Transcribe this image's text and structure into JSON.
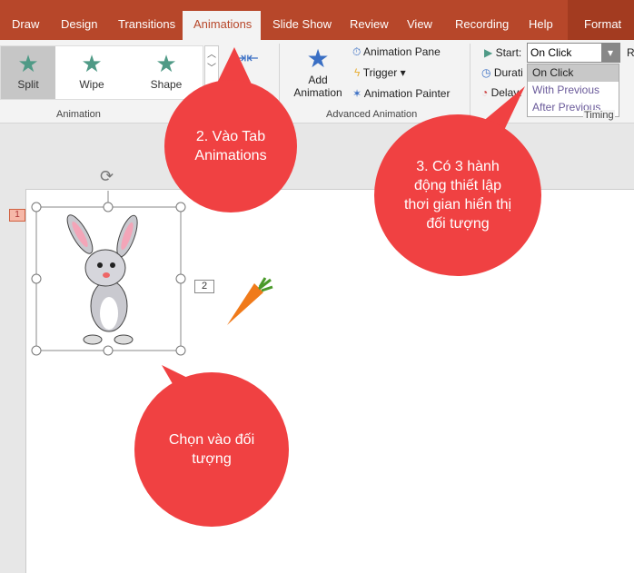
{
  "tabs": [
    "Draw",
    "Design",
    "Transitions",
    "Animations",
    "Slide Show",
    "Review",
    "View",
    "Recording",
    "Help",
    "Format"
  ],
  "animation_gallery": [
    {
      "label": "Split",
      "icon": "split-star-icon"
    },
    {
      "label": "Wipe",
      "icon": "wipe-star-icon"
    },
    {
      "label": "Shape",
      "icon": "shape-star-icon"
    }
  ],
  "groups": {
    "animation": "Animation",
    "advanced": "Advanced Animation",
    "timing": "Timing"
  },
  "advanced": {
    "add_animation_1": "Add",
    "add_animation_2": "Animation",
    "animation_pane": "Animation Pane",
    "trigger": "Trigger",
    "animation_painter": "Animation Painter"
  },
  "timing": {
    "start_label": "Start:",
    "start_value": "On Click",
    "duration_label": "Durati",
    "delay_label": "Delay:",
    "options": [
      "On Click",
      "With Previous",
      "After Previous"
    ]
  },
  "slide": {
    "thumb_number": "1",
    "anim_tag": "2"
  },
  "callouts": {
    "c1": "2. Vào Tab Animations",
    "c2": "3. Có 3 hành động thiết lập thơi gian hiển thị đối tượng",
    "c3": "Chọn vào đối tượng"
  },
  "colors": {
    "tab_bar": "#b7472a",
    "callout": "#f04142",
    "star": "#4f9a86"
  }
}
